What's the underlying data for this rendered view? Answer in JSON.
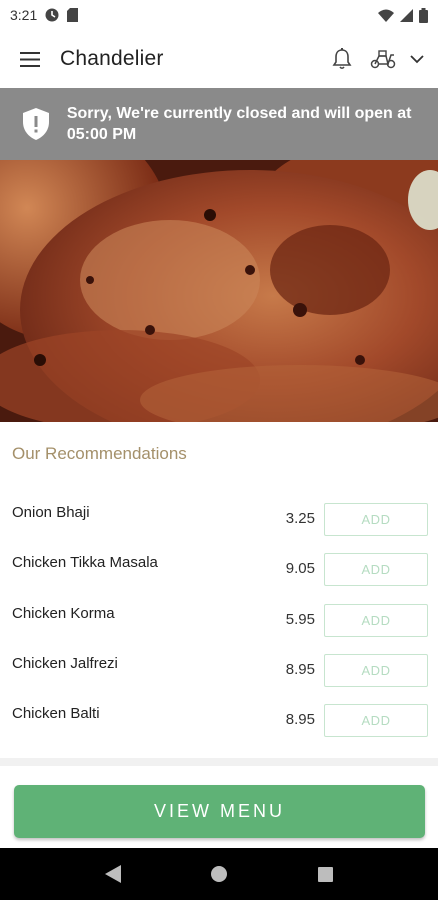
{
  "status_bar": {
    "time": "3:21"
  },
  "app_bar": {
    "title": "Chandelier"
  },
  "banner": {
    "message": "Sorry, We're currently closed and will open at 05:00 PM"
  },
  "recommendations": {
    "title": "Our Recommendations",
    "items": [
      {
        "name": "Onion Bhaji",
        "price": "3.25",
        "action": "ADD"
      },
      {
        "name": "Chicken Tikka Masala",
        "price": "9.05",
        "action": "ADD"
      },
      {
        "name": "Chicken Korma",
        "price": "5.95",
        "action": "ADD"
      },
      {
        "name": "Chicken Jalfrezi",
        "price": "8.95",
        "action": "ADD"
      },
      {
        "name": "Chicken Balti",
        "price": "8.95",
        "action": "ADD"
      }
    ]
  },
  "cta": {
    "label": "VIEW MENU"
  },
  "colors": {
    "accent_green": "#5fb276",
    "banner_gray": "#8a8a8a",
    "section_title": "#a4906a"
  },
  "icons": [
    "menu-icon",
    "bell-icon",
    "delivery-scooter-icon",
    "chevron-down-icon",
    "shield-alert-icon",
    "back-icon",
    "home-icon",
    "recents-icon"
  ]
}
